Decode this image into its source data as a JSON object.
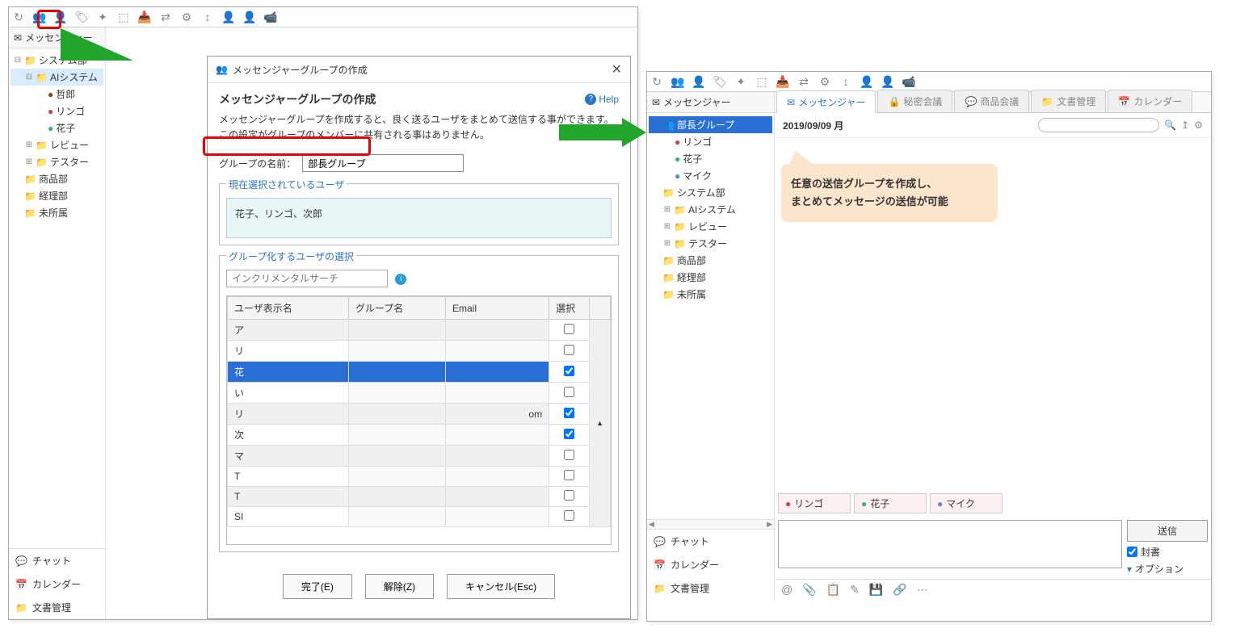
{
  "left_window": {
    "sidebar_title": "メッセンジャー",
    "tree": [
      {
        "label": "システム部",
        "type": "folder",
        "exp": "−"
      },
      {
        "label": "AIシステム",
        "type": "folder",
        "exp": "−",
        "indent": 1,
        "selected": true,
        "children": [
          {
            "label": "哲郎",
            "avatar": "avatar2"
          },
          {
            "label": "リンゴ",
            "avatar": "avatar1"
          },
          {
            "label": "花子",
            "avatar": "avatar3"
          }
        ]
      },
      {
        "label": "レビュー",
        "type": "folder",
        "exp": "+",
        "indent": 1
      },
      {
        "label": "テスター",
        "type": "folder",
        "exp": "+",
        "indent": 1
      },
      {
        "label": "商品部",
        "type": "folder"
      },
      {
        "label": "経理部",
        "type": "folder"
      },
      {
        "label": "未所属",
        "type": "folder"
      }
    ],
    "bottom_tabs": [
      {
        "icon": "💬",
        "label": "チャット"
      },
      {
        "icon": "📅",
        "label": "カレンダー"
      },
      {
        "icon": "📁",
        "label": "文書管理"
      }
    ]
  },
  "dialog": {
    "title": "メッセンジャーグループの作成",
    "heading": "メッセンジャーグループの作成",
    "help": "Help",
    "desc": "メッセンジャーグループを作成すると、良く送るユーザをまとめて送信する事ができます。この設定がグループのメンバーに共有される事はありません。",
    "name_label": "グループの名前：",
    "name_value": "部長グループ",
    "selected_users_legend": "現在選択されているユーザ",
    "selected_users_text": "花子、リンゴ、次郎",
    "user_select_legend": "グループ化するユーザの選択",
    "search_placeholder": "インクリメンタルサーチ",
    "table_headers": {
      "c1": "ユーザ表示名",
      "c2": "グループ名",
      "c3": "Email",
      "c4": "選択"
    },
    "rows": [
      {
        "c1": "ア",
        "checked": false
      },
      {
        "c1": "リ",
        "checked": false
      },
      {
        "c1": "花",
        "checked": true,
        "selected": true
      },
      {
        "c1": "い",
        "checked": false
      },
      {
        "c1": "リ",
        "c3suffix": "om",
        "checked": true
      },
      {
        "c1": "次",
        "checked": true
      },
      {
        "c1": "マ",
        "checked": false
      },
      {
        "c1": "T",
        "checked": false
      },
      {
        "c1": "T",
        "checked": false
      },
      {
        "c1": "SI",
        "checked": false
      }
    ],
    "buttons": {
      "done": "完了(E)",
      "clear": "解除(Z)",
      "cancel": "キャンセル(Esc)"
    }
  },
  "right_window": {
    "sidebar_title": "メッセンジャー",
    "tabs": [
      {
        "icon": "✉",
        "label": "メッセンジャー",
        "active": true,
        "color": "#2a74c9"
      },
      {
        "icon": "🔒",
        "label": "秘密会議"
      },
      {
        "icon": "💬",
        "label": "商品会議"
      },
      {
        "icon": "📁",
        "label": "文書管理"
      },
      {
        "icon": "📅",
        "label": "カレンダー"
      }
    ],
    "date_text": "2019/09/09 月",
    "tree": [
      {
        "label": "部長グループ",
        "type": "group",
        "selected": true,
        "icon": "👥",
        "children": [
          {
            "label": "リンゴ",
            "avatar": "avatar1"
          },
          {
            "label": "花子",
            "avatar": "avatar3"
          },
          {
            "label": "マイク",
            "avatar": "avatar4"
          }
        ]
      },
      {
        "label": "システム部",
        "type": "folder"
      },
      {
        "label": "AIシステム",
        "type": "folder",
        "exp": "+",
        "indent": 1
      },
      {
        "label": "レビュー",
        "type": "folder",
        "exp": "+",
        "indent": 1
      },
      {
        "label": "テスター",
        "type": "folder",
        "exp": "+",
        "indent": 1
      },
      {
        "label": "商品部",
        "type": "folder"
      },
      {
        "label": "経理部",
        "type": "folder"
      },
      {
        "label": "未所属",
        "type": "folder"
      }
    ],
    "callout_line1": "任意の送信グループを作成し、",
    "callout_line2": "まとめてメッセージの送信が可能",
    "recipients": [
      {
        "avatar": "avatar1",
        "label": "リンゴ"
      },
      {
        "avatar": "avatar3",
        "label": "花子"
      },
      {
        "avatar": "avatar4",
        "label": "マイク"
      }
    ],
    "send_button": "送信",
    "sealed_label": "封書",
    "options_label": "オプション",
    "bottom_tabs": [
      {
        "icon": "💬",
        "label": "チャット"
      },
      {
        "icon": "📅",
        "label": "カレンダー"
      },
      {
        "icon": "📁",
        "label": "文書管理"
      }
    ]
  }
}
